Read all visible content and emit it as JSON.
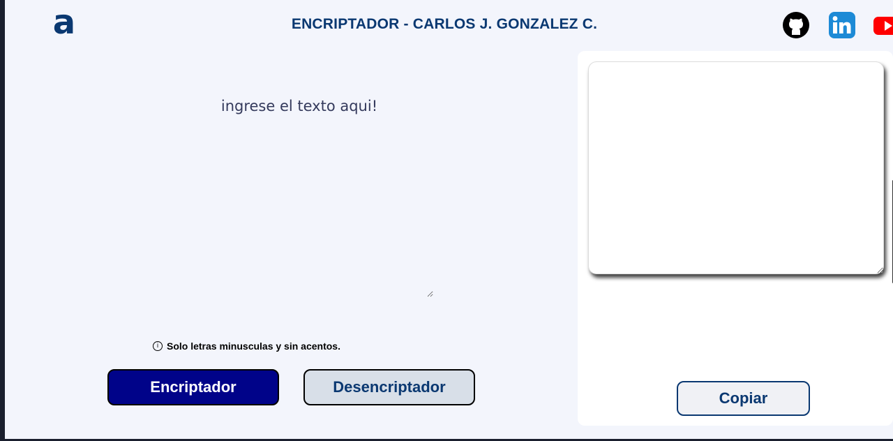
{
  "header": {
    "logo_text": "a",
    "title": "ENCRIPTADOR - CARLOS J. GONZALEZ C.",
    "social": [
      {
        "name": "github-icon",
        "color": "#000000"
      },
      {
        "name": "linkedin-icon",
        "color": "#0a66c2",
        "text": "in"
      },
      {
        "name": "youtube-icon",
        "color": "#ff0000"
      }
    ]
  },
  "input": {
    "placeholder": "ingrese el texto aqui!"
  },
  "hint": {
    "icon": "ⓘ",
    "text": "Solo letras minusculas y sin acentos."
  },
  "buttons": {
    "encrypt_label": "Encriptador",
    "decrypt_label": "Desencriptador",
    "copy_label": "Copiar"
  },
  "colors": {
    "primary": "#0a3871",
    "encrypt_bg": "#000389",
    "page_bg": "#f3f5fc"
  }
}
